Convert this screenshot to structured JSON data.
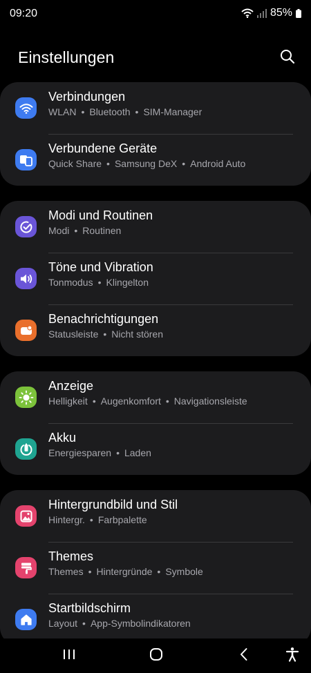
{
  "status_bar": {
    "time": "09:20",
    "battery": "85%",
    "icons": [
      "wifi-icon",
      "signal-icon",
      "battery-icon"
    ]
  },
  "header": {
    "title": "Einstellungen",
    "search_icon": "search-icon"
  },
  "groups": [
    {
      "items": [
        {
          "title": "Verbindungen",
          "subtitle": [
            "WLAN",
            "Bluetooth",
            "SIM-Manager"
          ],
          "icon": "wifi-icon",
          "color": "#3e7bf0"
        },
        {
          "title": "Verbundene Geräte",
          "subtitle": [
            "Quick Share",
            "Samsung DeX",
            "Android Auto"
          ],
          "icon": "devices-icon",
          "color": "#3e7bf0"
        }
      ]
    },
    {
      "items": [
        {
          "title": "Modi und Routinen",
          "subtitle": [
            "Modi",
            "Routinen"
          ],
          "icon": "check-circle-icon",
          "color": "#6a55d8"
        },
        {
          "title": "Töne und Vibration",
          "subtitle": [
            "Tonmodus",
            "Klingelton"
          ],
          "icon": "speaker-icon",
          "color": "#6a55d8"
        },
        {
          "title": "Benachrichtigungen",
          "subtitle": [
            "Statusleiste",
            "Nicht stören"
          ],
          "icon": "notification-icon",
          "color": "#e96f2c"
        }
      ]
    },
    {
      "items": [
        {
          "title": "Anzeige",
          "subtitle": [
            "Helligkeit",
            "Augenkomfort",
            "Navigationsleiste"
          ],
          "icon": "sun-icon",
          "color": "#7cc23b"
        },
        {
          "title": "Akku",
          "subtitle": [
            "Energiesparen",
            "Laden"
          ],
          "icon": "battery-care-icon",
          "color": "#1fa491"
        }
      ]
    },
    {
      "items": [
        {
          "title": "Hintergrundbild und Stil",
          "subtitle": [
            "Hintergr.",
            "Farbpalette"
          ],
          "icon": "wallpaper-icon",
          "color": "#e4436d"
        },
        {
          "title": "Themes",
          "subtitle": [
            "Themes",
            "Hintergründe",
            "Symbole"
          ],
          "icon": "brush-icon",
          "color": "#e4436d"
        },
        {
          "title": "Startbildschirm",
          "subtitle": [
            "Layout",
            "App-Symbolindikatoren"
          ],
          "icon": "home-icon",
          "color": "#3e7bf0"
        }
      ]
    }
  ],
  "nav_bar": {
    "buttons": [
      "recents-icon",
      "home-button-icon",
      "back-icon",
      "accessibility-icon"
    ]
  }
}
